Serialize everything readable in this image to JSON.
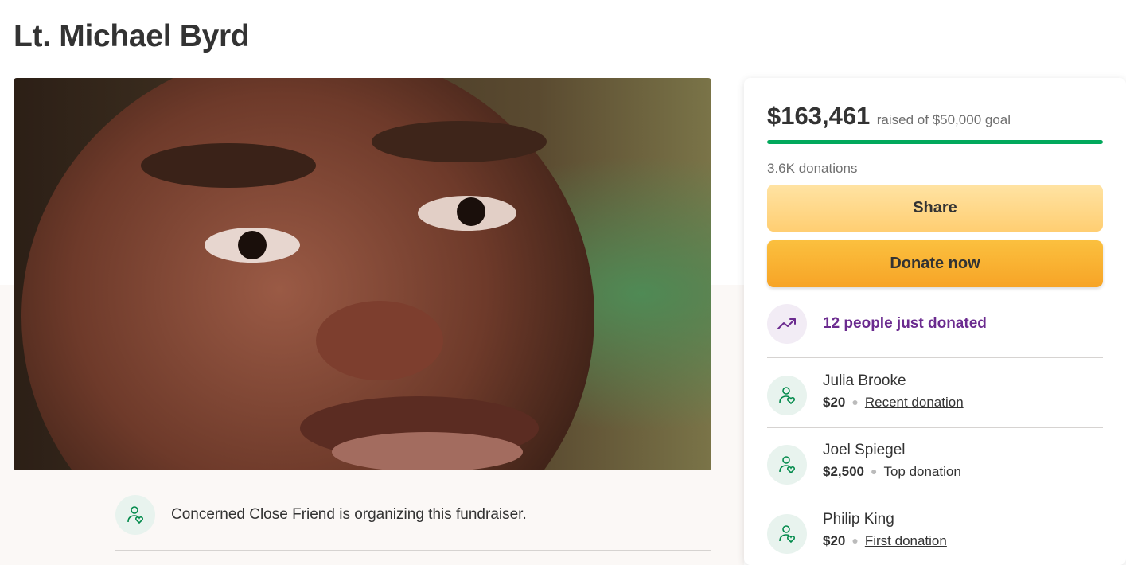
{
  "page": {
    "title": "Lt. Michael Byrd"
  },
  "organizer": {
    "text": "Concerned Close Friend is organizing this fundraiser.",
    "icon": "person-heart-icon"
  },
  "campaign": {
    "raised_amount": "$163,461",
    "goal_text": "raised of $50,000 goal",
    "progress_fraction": 1.0,
    "donations_count": "3.6K donations",
    "share_label": "Share",
    "donate_label": "Donate now",
    "trend_text": "12 people just donated",
    "trend_icon": "trending-up-icon"
  },
  "donations": [
    {
      "name": "Julia Brooke",
      "amount": "$20",
      "tag": "Recent donation"
    },
    {
      "name": "Joel Spiegel",
      "amount": "$2,500",
      "tag": "Top donation"
    },
    {
      "name": "Philip King",
      "amount": "$20",
      "tag": "First donation"
    }
  ],
  "colors": {
    "progress": "#02a95c",
    "trend_text": "#6b2b8f",
    "donate": "#f7a426",
    "share": "#ffce72"
  }
}
